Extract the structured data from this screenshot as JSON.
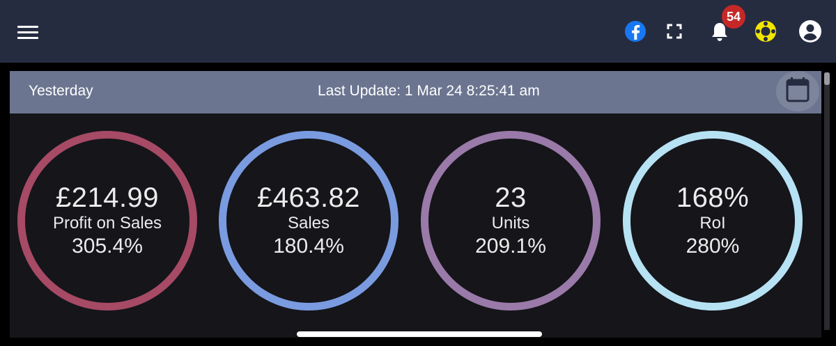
{
  "topbar": {
    "menu_icon": "hamburger-menu-icon",
    "facebook_icon": "facebook-icon",
    "fullscreen_icon": "fullscreen-icon",
    "notifications_icon": "bell-icon",
    "notifications_count": "54",
    "support_icon": "lifebuoy-icon",
    "account_icon": "account-circle-icon",
    "colors": {
      "background": "#262c40",
      "facebook": "#1877f2",
      "badge": "#c62828",
      "support": "#f2e600"
    }
  },
  "summary": {
    "period_label": "Yesterday",
    "last_update": "Last Update: 1 Mar 24 8:25:41 am",
    "calendar_icon": "calendar-icon",
    "kpis": [
      {
        "value": "£214.99",
        "label": "Profit on Sales",
        "change": "305.4%",
        "ring_color": "#a64a66"
      },
      {
        "value": "£463.82",
        "label": "Sales",
        "change": "180.4%",
        "ring_color": "#7a9be0"
      },
      {
        "value": "23",
        "label": "Units",
        "change": "209.1%",
        "ring_color": "#9a7aa8"
      },
      {
        "value": "168%",
        "label": "RoI",
        "change": "280%",
        "ring_color": "#b6e2f4"
      }
    ]
  }
}
